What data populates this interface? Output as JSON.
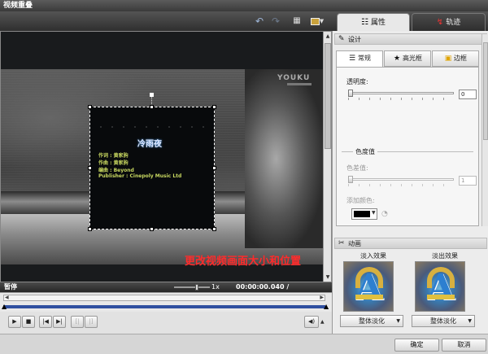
{
  "window": {
    "title": "视频重叠"
  },
  "toolbar": {
    "undo_icon": "undo-icon",
    "redo_icon": "redo-icon",
    "grid_icon": "grid-icon",
    "monitor_icon": "monitor-icon",
    "monitor_color": "#c9a23d"
  },
  "tabs": [
    {
      "label": "属性",
      "icon": "properties-icon",
      "active": true
    },
    {
      "label": "轨迹",
      "icon": "track-icon",
      "active": false
    }
  ],
  "preview": {
    "watermark": "YOUKU",
    "overlay_title": "冷雨夜",
    "credits": [
      "作词 : 黄家驹",
      "作曲 : 黄家驹",
      "编曲 : Beyond",
      "Publisher : Cinepoly Music Ltd"
    ],
    "caption": "更改视频画面大小和位置"
  },
  "status": {
    "label": "暂停",
    "speed": "1x",
    "time": "00:00:00.040 / 00:03:20.600"
  },
  "design": {
    "header": "设计",
    "subtabs": [
      {
        "label": "常规",
        "icon": "general-icon",
        "active": true
      },
      {
        "label": "高光框",
        "icon": "star-icon",
        "active": false
      },
      {
        "label": "边框",
        "icon": "border-icon",
        "active": false
      }
    ],
    "opacity_label": "透明度:",
    "opacity_value": "0",
    "chroma_group": "色度值",
    "chroma_label": "色差值:",
    "chroma_value": "1",
    "add_color_label": "添加颜色:",
    "color_value": "#000000"
  },
  "animation": {
    "header": "动画",
    "in_label": "淡入效果",
    "out_label": "淡出效果",
    "in_select": "整体淡化",
    "out_select": "整体淡化"
  },
  "buttons": {
    "ok": "确定",
    "cancel": "取消"
  }
}
